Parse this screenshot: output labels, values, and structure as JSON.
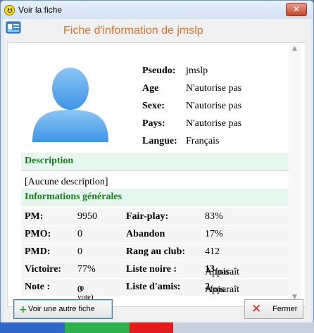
{
  "window": {
    "title": "Voir la fiche",
    "close_glyph": "✕"
  },
  "header": {
    "title": "Fiche d'information de jmslp",
    "icon": "contact-card-icon"
  },
  "profile": {
    "avatar": "user-avatar-silhouette",
    "fields": [
      {
        "label": "Pseudo:",
        "value": "jmslp"
      },
      {
        "label": "Age",
        "value": "N'autorise pas"
      },
      {
        "label": "Sexe:",
        "value": "N'autorise pas"
      },
      {
        "label": "Pays:",
        "value": "N'autorise pas"
      },
      {
        "label": "Langue:",
        "value": "Français"
      }
    ]
  },
  "description": {
    "heading": "Description",
    "text": "[Aucune description]"
  },
  "general": {
    "heading": "Informations générales",
    "rows": [
      {
        "k1": "PM:",
        "v1": "9950",
        "k2": "Fair-play:",
        "v2": "83%"
      },
      {
        "k1": "PMO:",
        "v1": "0",
        "k2": "Abandon",
        "v2": "17%"
      },
      {
        "k1": "PMD:",
        "v1": "0",
        "k2": "Rang au club:",
        "v2": "412"
      },
      {
        "k1": "Victoire:",
        "v1": "77%",
        "k2": "Liste noire :",
        "v2_pre": "Apparaît ",
        "v2_num": "13",
        "v2_post": " fois"
      },
      {
        "k1": "Note :",
        "v1": "0",
        "v1_small": "(0 vote)",
        "k2": "Liste d'amis:",
        "v2_pre": "Apparaît ",
        "v2_num": "2",
        "v2_post": " fois"
      }
    ]
  },
  "buttons": {
    "other": "Voir une autre fiche",
    "close": "Fermer"
  },
  "colors": {
    "title_orange": "#e0702a",
    "section_green": "#1a7f1a",
    "section_bg": "#e6f7ef",
    "accent_blue": "#3c7fb1"
  }
}
